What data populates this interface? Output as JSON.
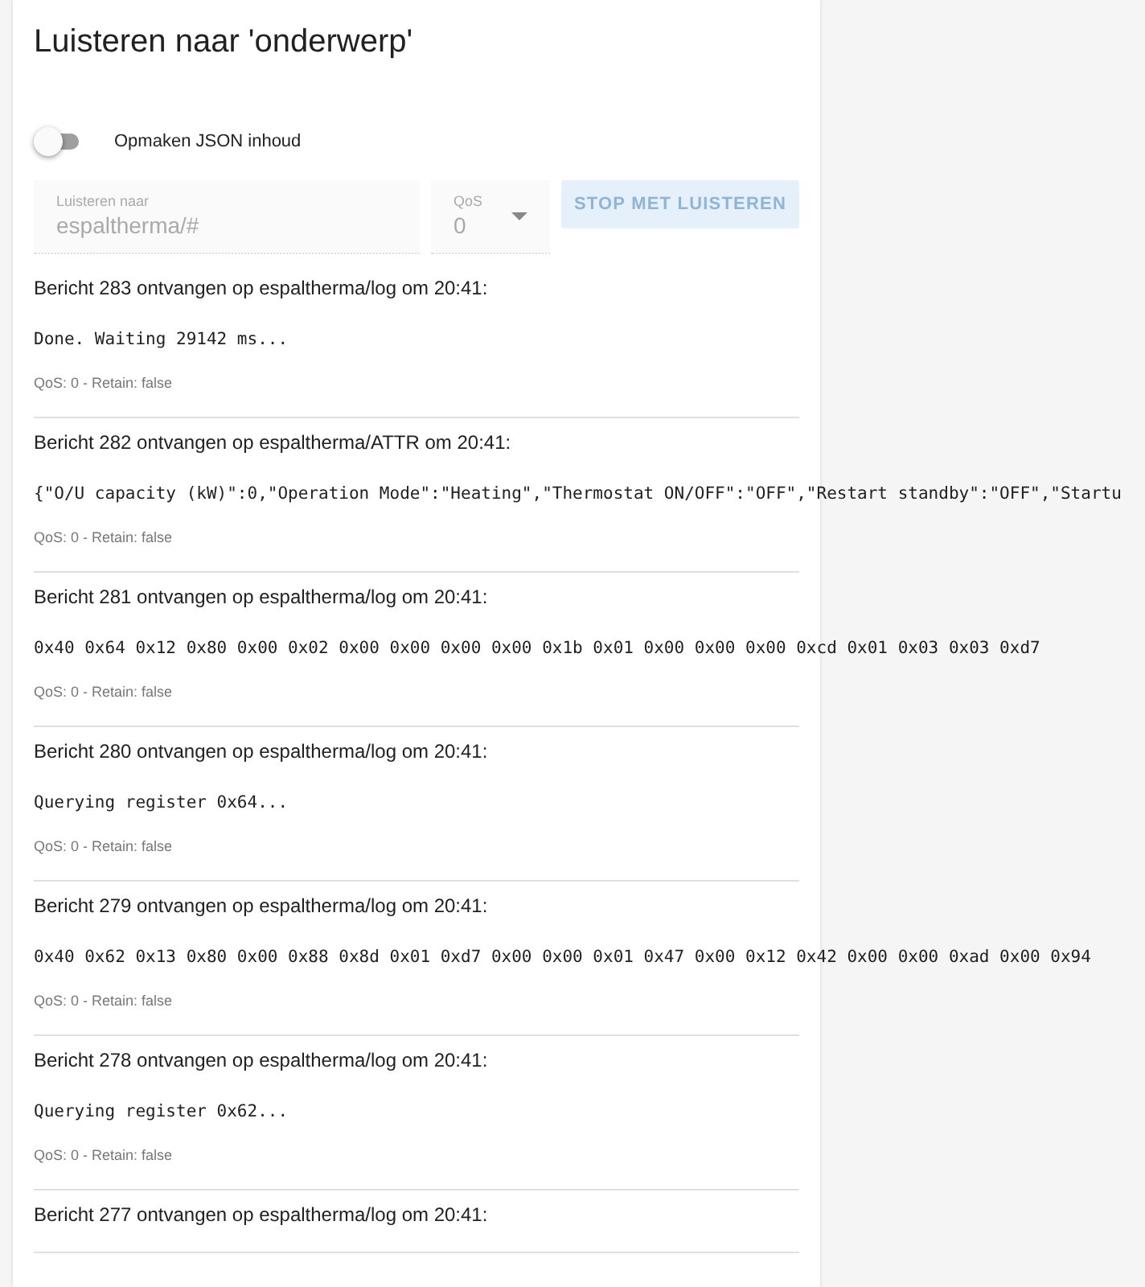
{
  "title": "Luisteren naar 'onderwerp'",
  "format_toggle": {
    "label": "Opmaken JSON inhoud",
    "on": false
  },
  "topic_field": {
    "label": "Luisteren naar",
    "value": "espaltherma/#",
    "disabled": true
  },
  "qos_select": {
    "label": "QoS",
    "value": "0",
    "disabled": true
  },
  "stop_button": {
    "label": "STOP MET LUISTEREN"
  },
  "messages": [
    {
      "header": "Bericht 283 ontvangen op espaltherma/log om 20:41:",
      "payload": "Done. Waiting 29142 ms...",
      "meta": "QoS: 0 - Retain: false"
    },
    {
      "header": "Bericht 282 ontvangen op espaltherma/ATTR om 20:41:",
      "payload": "{\"O/U capacity (kW)\":0,\"Operation Mode\":\"Heating\",\"Thermostat ON/OFF\":\"OFF\",\"Restart standby\":\"OFF\",\"Startu",
      "meta": "QoS: 0 - Retain: false"
    },
    {
      "header": "Bericht 281 ontvangen op espaltherma/log om 20:41:",
      "payload": "0x40 0x64 0x12 0x80 0x00 0x02 0x00 0x00 0x00 0x00 0x1b 0x01 0x00 0x00 0x00 0xcd 0x01 0x03 0x03 0xd7",
      "meta": "QoS: 0 - Retain: false"
    },
    {
      "header": "Bericht 280 ontvangen op espaltherma/log om 20:41:",
      "payload": "Querying register 0x64...",
      "meta": "QoS: 0 - Retain: false"
    },
    {
      "header": "Bericht 279 ontvangen op espaltherma/log om 20:41:",
      "payload": "0x40 0x62 0x13 0x80 0x00 0x88 0x8d 0x01 0xd7 0x00 0x00 0x01 0x47 0x00 0x12 0x42 0x00 0x00 0xad 0x00 0x94",
      "meta": "QoS: 0 - Retain: false"
    },
    {
      "header": "Bericht 278 ontvangen op espaltherma/log om 20:41:",
      "payload": "Querying register 0x62...",
      "meta": "QoS: 0 - Retain: false"
    },
    {
      "header": "Bericht 277 ontvangen op espaltherma/log om 20:41:"
    }
  ]
}
